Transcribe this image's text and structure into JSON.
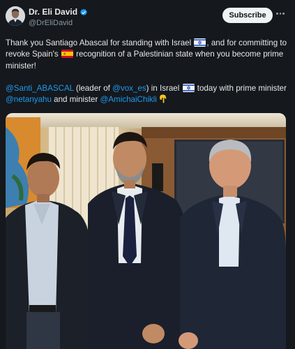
{
  "author": {
    "display_name": "Dr. Eli David",
    "handle": "@DrEliDavid",
    "avatar_icon": "person-avatar",
    "verified_icon": "verified-badge-icon",
    "verified_color": "#1d9bf0"
  },
  "actions": {
    "subscribe_label": "Subscribe",
    "more_icon": "more-horizontal-icon"
  },
  "post": {
    "para1": {
      "t1": "Thank you Santiago Abascal for standing with Israel ",
      "t2": ", and for committing to revoke Spain's ",
      "t3": " recognition of a Palestinian state when you become prime minister!"
    },
    "para2": {
      "m1": "@Santi_ABASCAL",
      "t1": " (leader of ",
      "m2": "@vox_es",
      "t2": ") in Israel ",
      "t3": " today with prime minister ",
      "m3": "@netanyahu",
      "t4": " and minister ",
      "m4": "@AmichaiChikli",
      "t5": " "
    },
    "emojis": [
      "israel-flag",
      "spain-flag",
      "israel-flag",
      "pointing-down-hand"
    ],
    "mention_color": "#1d9bf0"
  },
  "media": {
    "type": "photo",
    "description_icon": "group-photo-image"
  }
}
